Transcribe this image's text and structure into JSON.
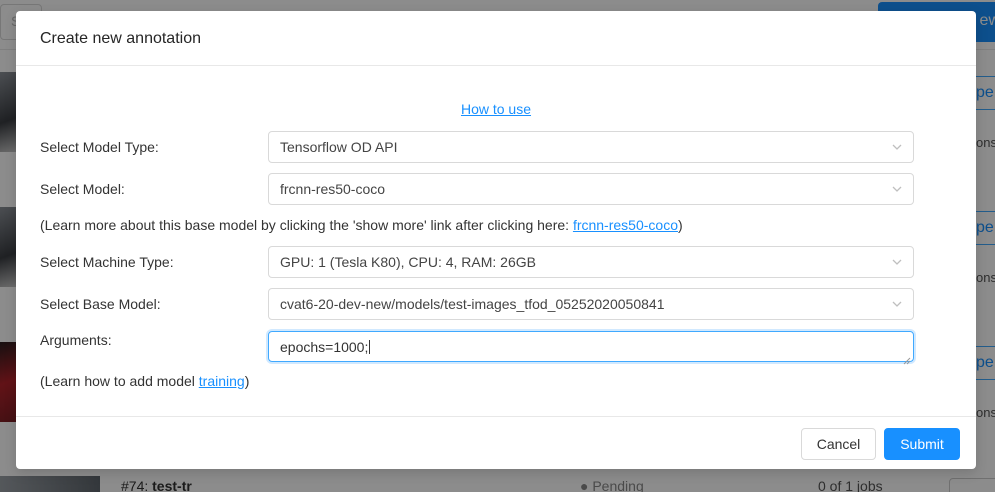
{
  "modal": {
    "title": "Create new annotation",
    "how_to_use_link": "How to use",
    "model_type": {
      "label": "Select Model Type:",
      "value": "Tensorflow OD API"
    },
    "model": {
      "label": "Select Model:",
      "value": "frcnn-res50-coco"
    },
    "model_info": {
      "prefix": "(Learn more about this base model by clicking the 'show more' link after clicking here: ",
      "link": "frcnn-res50-coco",
      "suffix": ")"
    },
    "machine_type": {
      "label": "Select Machine Type:",
      "value": "GPU: 1 (Tesla K80), CPU: 4, RAM: 26GB"
    },
    "base_model": {
      "label": "Select Base Model:",
      "value": "cvat6-20-dev-new/models/test-images_tfod_05252020050841"
    },
    "arguments": {
      "label": "Arguments:",
      "value": "epochs=1000;"
    },
    "training_info": {
      "prefix": "(Learn how to add model  ",
      "link": "training",
      "suffix": ")"
    },
    "cancel_label": "Cancel",
    "submit_label": "Submit"
  },
  "background": {
    "search_placeholder": "S",
    "new_button_label": "ew",
    "right_button_label": "pe",
    "right_text": "ons",
    "row": {
      "id": "#74:",
      "name": "test-tr",
      "status": "● Pending",
      "jobs": "0 of 1 jobs"
    }
  },
  "colors": {
    "primary": "#1890ff",
    "overlay": "rgba(0,0,0,0.45)"
  }
}
